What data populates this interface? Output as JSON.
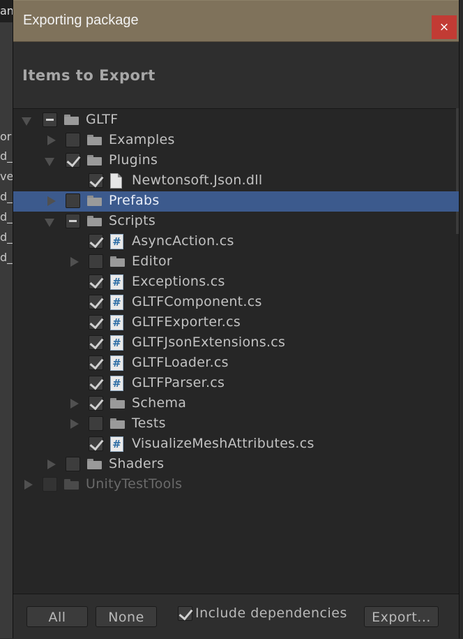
{
  "background": {
    "top_fragment": "an",
    "side_fragments": [
      "or",
      "d_",
      "ve",
      "d_",
      "d_",
      "d_",
      "d_"
    ]
  },
  "dialog": {
    "title": "Exporting package",
    "close_symbol": "×",
    "heading": "Items to Export"
  },
  "tree": [
    {
      "label": "GLTF",
      "fold": "expanded",
      "check": "mixed",
      "icon": "folder-icon"
    },
    {
      "label": "Examples",
      "fold": "collapsed",
      "check": "unchecked",
      "icon": "folder-icon"
    },
    {
      "label": "Plugins",
      "fold": "expanded",
      "check": "checked",
      "icon": "folder-icon"
    },
    {
      "label": "Newtonsoft.Json.dll",
      "fold": "none",
      "check": "checked",
      "icon": "dll-file-icon"
    },
    {
      "label": "Prefabs",
      "fold": "collapsed",
      "check": "unchecked",
      "icon": "folder-icon",
      "selected": true
    },
    {
      "label": "Scripts",
      "fold": "expanded",
      "check": "mixed",
      "icon": "folder-icon"
    },
    {
      "label": "AsyncAction.cs",
      "fold": "none",
      "check": "checked",
      "icon": "csharp-file-icon"
    },
    {
      "label": "Editor",
      "fold": "collapsed",
      "check": "unchecked",
      "icon": "folder-icon"
    },
    {
      "label": "Exceptions.cs",
      "fold": "none",
      "check": "checked",
      "icon": "csharp-file-icon"
    },
    {
      "label": "GLTFComponent.cs",
      "fold": "none",
      "check": "checked",
      "icon": "csharp-file-icon"
    },
    {
      "label": "GLTFExporter.cs",
      "fold": "none",
      "check": "checked",
      "icon": "csharp-file-icon"
    },
    {
      "label": "GLTFJsonExtensions.cs",
      "fold": "none",
      "check": "checked",
      "icon": "csharp-file-icon"
    },
    {
      "label": "GLTFLoader.cs",
      "fold": "none",
      "check": "checked",
      "icon": "csharp-file-icon"
    },
    {
      "label": "GLTFParser.cs",
      "fold": "none",
      "check": "checked",
      "icon": "csharp-file-icon"
    },
    {
      "label": "Schema",
      "fold": "collapsed",
      "check": "checked",
      "icon": "folder-icon"
    },
    {
      "label": "Tests",
      "fold": "collapsed",
      "check": "unchecked",
      "icon": "folder-icon"
    },
    {
      "label": "VisualizeMeshAttributes.cs",
      "fold": "none",
      "check": "checked",
      "icon": "csharp-file-icon"
    },
    {
      "label": "Shaders",
      "fold": "collapsed",
      "check": "unchecked",
      "icon": "folder-icon"
    },
    {
      "label": "UnityTestTools",
      "fold": "collapsed",
      "check": "unchecked",
      "icon": "folder-icon",
      "faded": true
    }
  ],
  "footer": {
    "all_label": "All",
    "none_label": "None",
    "include_dependencies_label": "Include dependencies",
    "include_dependencies_checked": true,
    "export_label": "Export..."
  },
  "colors": {
    "titlebar": "#7f725b",
    "close_button": "#c23b34",
    "selection": "#3c5a8d",
    "panel": "#262626"
  }
}
